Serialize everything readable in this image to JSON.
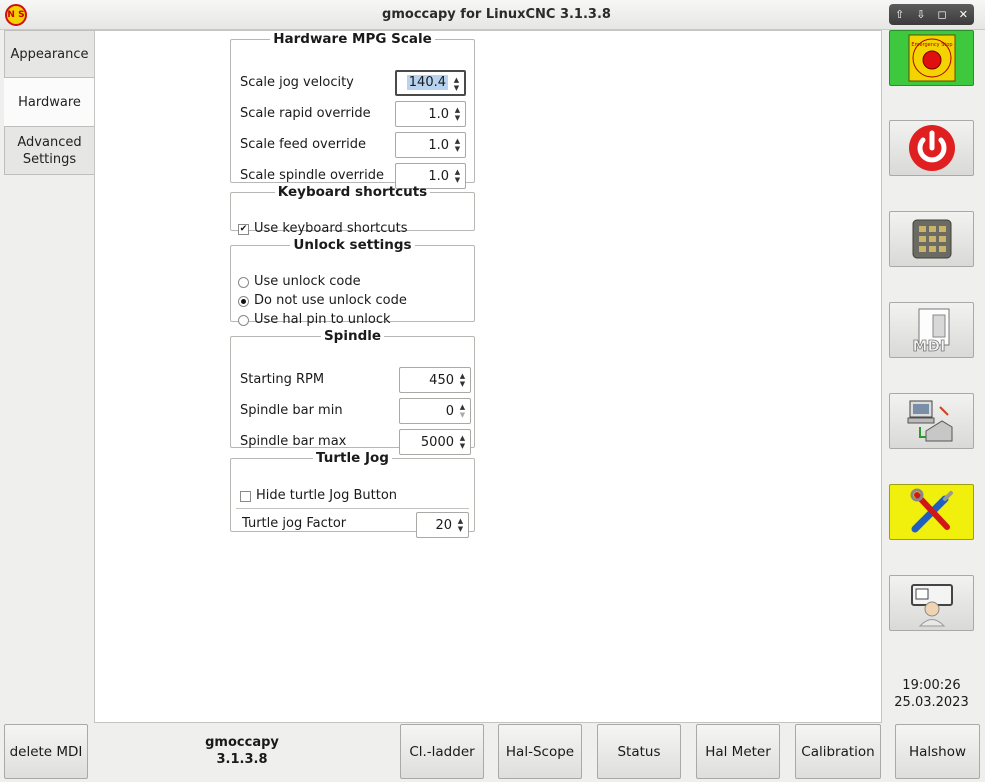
{
  "window": {
    "title": "gmoccapy for LinuxCNC  3.1.3.8",
    "logo_text": "N S",
    "controls": [
      "⇧",
      "⇩",
      "◻",
      "✕"
    ]
  },
  "tabs": [
    {
      "label": "Appearance",
      "active": false
    },
    {
      "label": "Hardware",
      "active": true
    },
    {
      "label": "Advanced Settings",
      "active": false
    }
  ],
  "mpg": {
    "title": "Hardware MPG Scale",
    "rows": [
      {
        "label": "Scale jog velocity",
        "value": "140.4",
        "focused": true
      },
      {
        "label": "Scale rapid override",
        "value": "1.0"
      },
      {
        "label": "Scale feed override",
        "value": "1.0"
      },
      {
        "label": "Scale spindle override",
        "value": "1.0"
      }
    ]
  },
  "keyboard": {
    "title": "Keyboard shortcuts",
    "use_shortcuts_label": "Use keyboard shortcuts",
    "use_shortcuts_checked": true
  },
  "unlock": {
    "title": "Unlock settings",
    "options": [
      {
        "label": "Use unlock code",
        "selected": false
      },
      {
        "label": "Do not use unlock code",
        "selected": true
      },
      {
        "label": "Use hal pin to unlock",
        "selected": false
      }
    ]
  },
  "spindle": {
    "title": "Spindle",
    "rows": [
      {
        "label": "Starting RPM",
        "value": "450"
      },
      {
        "label": "Spindle bar min",
        "value": "0"
      },
      {
        "label": "Spindle bar max",
        "value": "5000"
      }
    ]
  },
  "turtle": {
    "title": "Turtle Jog",
    "hide_label": "Hide turtle Jog Button",
    "hide_checked": false,
    "factor_label": "Turtle jog Factor",
    "factor_value": "20"
  },
  "side_buttons": {
    "estop_label": "Emergency Stop",
    "mdi_label": "MDI"
  },
  "clock": {
    "time": "19:00:26",
    "date": "25.03.2023"
  },
  "bottom": {
    "delete_mdi": "delete MDI",
    "app_name": "gmoccapy",
    "app_version": "3.1.3.8",
    "buttons": [
      "Cl.-ladder",
      "Hal-Scope",
      "Status",
      "Hal Meter",
      "Calibration",
      "Halshow"
    ]
  },
  "colors": {
    "estop_bg": "#3ec83e",
    "settings_bg": "#f1ef0c",
    "power_red": "#e02020",
    "focus_highlight": "#b8d3ef"
  }
}
